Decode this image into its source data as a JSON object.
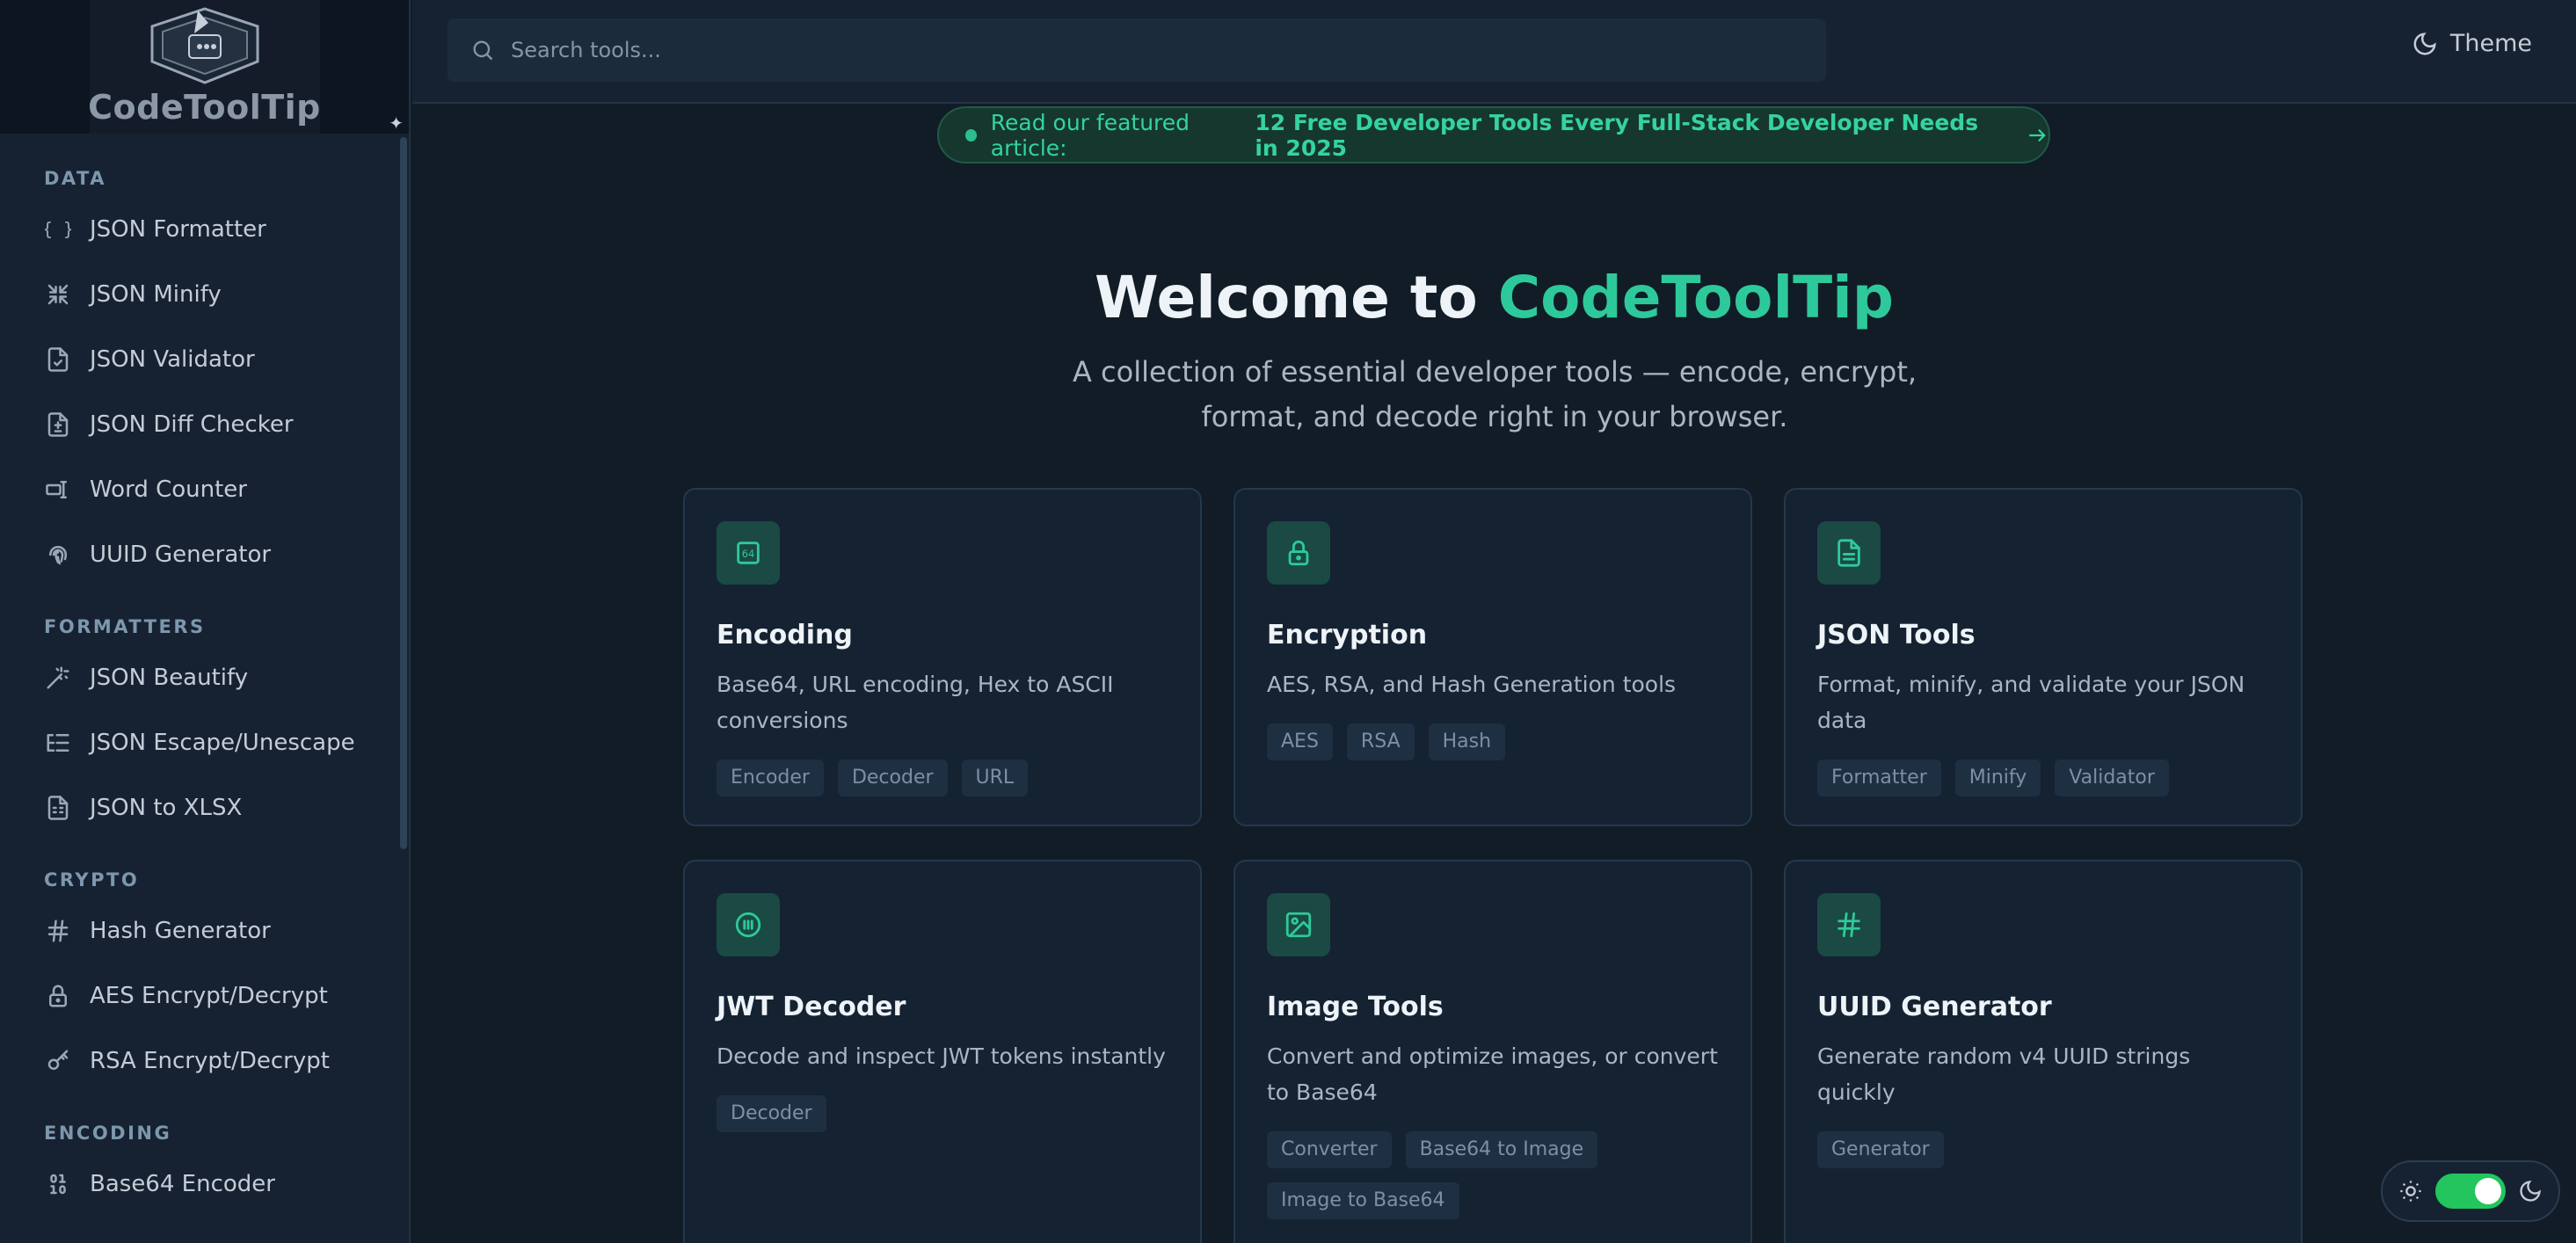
{
  "brand": {
    "name": "CodeToolTip"
  },
  "sidebar": {
    "sections": [
      {
        "title": "DATA",
        "items": [
          {
            "label": "JSON Formatter",
            "icon": "braces-icon"
          },
          {
            "label": "JSON Minify",
            "icon": "minimize-icon"
          },
          {
            "label": "JSON Validator",
            "icon": "file-check-icon"
          },
          {
            "label": "JSON Diff Checker",
            "icon": "file-diff-icon"
          },
          {
            "label": "Word Counter",
            "icon": "text-cursor-icon"
          },
          {
            "label": "UUID Generator",
            "icon": "fingerprint-icon"
          }
        ]
      },
      {
        "title": "FORMATTERS",
        "items": [
          {
            "label": "JSON Beautify",
            "icon": "wand-icon"
          },
          {
            "label": "JSON Escape/Unescape",
            "icon": "list-tree-icon"
          },
          {
            "label": "JSON to XLSX",
            "icon": "spreadsheet-icon"
          }
        ]
      },
      {
        "title": "CRYPTO",
        "items": [
          {
            "label": "Hash Generator",
            "icon": "hash-icon"
          },
          {
            "label": "AES Encrypt/Decrypt",
            "icon": "lock-icon"
          },
          {
            "label": "RSA Encrypt/Decrypt",
            "icon": "key-icon"
          }
        ]
      },
      {
        "title": "ENCODING",
        "items": [
          {
            "label": "Base64 Encoder",
            "icon": "binary-icon"
          }
        ]
      }
    ]
  },
  "topbar": {
    "search_placeholder": "Search tools...",
    "theme_label": "Theme"
  },
  "banner": {
    "prefix": "Read our featured article:",
    "link": "12 Free Developer Tools Every Full-Stack Developer Needs in 2025"
  },
  "hero": {
    "title_prefix": "Welcome to ",
    "title_accent": "CodeToolTip",
    "subtitle_line1": "A collection of essential developer tools — encode, encrypt,",
    "subtitle_line2": "format, and decode right in your browser."
  },
  "cards": [
    {
      "title": "Encoding",
      "desc": "Base64, URL encoding, Hex to ASCII conversions",
      "icon": "base64-icon",
      "tags": [
        "Encoder",
        "Decoder",
        "URL"
      ]
    },
    {
      "title": "Encryption",
      "desc": "AES, RSA, and Hash Generation tools",
      "icon": "lock-icon",
      "tags": [
        "AES",
        "RSA",
        "Hash"
      ]
    },
    {
      "title": "JSON Tools",
      "desc": "Format, minify, and validate your JSON data",
      "icon": "file-text-icon",
      "tags": [
        "Formatter",
        "Minify",
        "Validator"
      ]
    },
    {
      "title": "JWT Decoder",
      "desc": "Decode and inspect JWT tokens instantly",
      "icon": "token-icon",
      "tags": [
        "Decoder"
      ]
    },
    {
      "title": "Image Tools",
      "desc": "Convert and optimize images, or convert to Base64",
      "icon": "image-icon",
      "tags": [
        "Converter",
        "Base64 to Image",
        "Image to Base64"
      ]
    },
    {
      "title": "UUID Generator",
      "desc": "Generate random v4 UUID strings quickly",
      "icon": "hash-icon",
      "tags": [
        "Generator"
      ]
    }
  ],
  "colors": {
    "accent": "#2ec99a",
    "background": "#111c27",
    "toggle_on": "#22c55e"
  },
  "mode_toggle": {
    "dark_mode_on": true
  }
}
